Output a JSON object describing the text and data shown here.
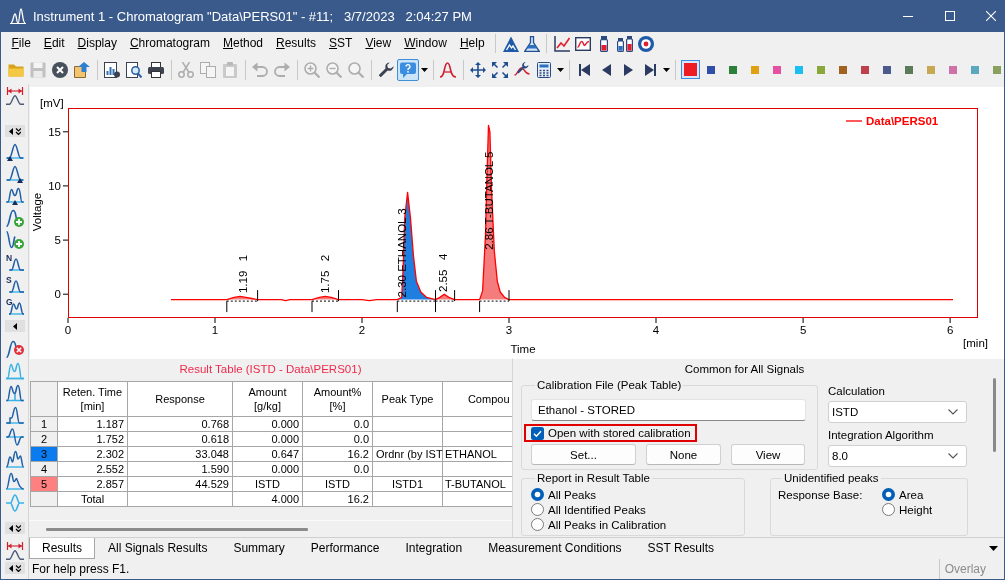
{
  "window": {
    "title": "Instrument 1 - Chromatogram \"Data\\PERS01\" - #11;   3/7/2023   2:04:27 PM"
  },
  "menu": {
    "items": [
      "File",
      "Edit",
      "Display",
      "Chromatogram",
      "Method",
      "Results",
      "SST",
      "View",
      "Window",
      "Help"
    ],
    "icon_groups": [
      [
        {
          "kind": "mountain"
        },
        {
          "kind": "flask"
        }
      ],
      [
        {
          "kind": "line-chart"
        },
        {
          "kind": "chart-window"
        },
        {
          "kind": "vial"
        },
        {
          "kind": "vials"
        },
        {
          "kind": "target"
        }
      ]
    ]
  },
  "toolbar": {
    "groups": [
      [
        {
          "kind": "open",
          "disabled": false,
          "pressed": false
        },
        {
          "kind": "save",
          "disabled": true,
          "pressed": false
        },
        {
          "kind": "close",
          "disabled": false,
          "pressed": false
        },
        {
          "kind": "export",
          "disabled": false,
          "pressed": false
        }
      ],
      [
        {
          "kind": "report",
          "disabled": false,
          "pressed": false
        },
        {
          "kind": "preview",
          "disabled": false,
          "pressed": false
        },
        {
          "kind": "print",
          "disabled": false,
          "pressed": false
        }
      ],
      [
        {
          "kind": "cut",
          "disabled": true,
          "pressed": false
        },
        {
          "kind": "copy",
          "disabled": true,
          "pressed": false
        },
        {
          "kind": "paste",
          "disabled": true,
          "pressed": false
        }
      ],
      [
        {
          "kind": "undo",
          "disabled": true,
          "pressed": false
        },
        {
          "kind": "redo",
          "disabled": true,
          "pressed": false
        }
      ],
      [
        {
          "kind": "zoom-in",
          "disabled": true,
          "pressed": false
        },
        {
          "kind": "zoom-out",
          "disabled": true,
          "pressed": false
        },
        {
          "kind": "zoom",
          "disabled": true,
          "pressed": false
        }
      ],
      [
        {
          "kind": "wrench",
          "disabled": false,
          "pressed": false
        },
        {
          "kind": "help",
          "disabled": false,
          "pressed": true
        },
        {
          "kind": "dropdown",
          "disabled": false,
          "pressed": false
        }
      ],
      [
        {
          "kind": "signal",
          "disabled": false,
          "pressed": false
        }
      ],
      [
        {
          "kind": "move",
          "disabled": false,
          "pressed": false
        },
        {
          "kind": "fit",
          "disabled": false,
          "pressed": false
        },
        {
          "kind": "tools",
          "disabled": false,
          "pressed": false
        },
        {
          "kind": "calculator",
          "disabled": false,
          "pressed": false
        },
        {
          "kind": "dropdown",
          "disabled": false,
          "pressed": false
        }
      ],
      [
        {
          "kind": "first",
          "disabled": false,
          "pressed": false
        },
        {
          "kind": "previous",
          "disabled": false,
          "pressed": false
        },
        {
          "kind": "next",
          "disabled": false,
          "pressed": false
        },
        {
          "kind": "last",
          "disabled": false,
          "pressed": false
        },
        {
          "kind": "dropdown",
          "disabled": false,
          "pressed": false
        }
      ]
    ],
    "colors": [
      {
        "color": "#ee1c24",
        "selected": true
      },
      {
        "color": "#2f4ea6",
        "selected": false
      },
      {
        "color": "#2a7f3a",
        "selected": false
      },
      {
        "color": "#e0a010",
        "selected": false
      },
      {
        "color": "#e650a0",
        "selected": false
      },
      {
        "color": "#18bff0",
        "selected": false
      },
      {
        "color": "#8aa83a",
        "selected": false
      },
      {
        "color": "#a0621e",
        "selected": false
      },
      {
        "color": "#c0404a",
        "selected": false
      },
      {
        "color": "#4a5a8a",
        "selected": false
      },
      {
        "color": "#5a7a5a",
        "selected": false
      },
      {
        "color": "#c8a850",
        "selected": false
      },
      {
        "color": "#d070a8",
        "selected": false
      },
      {
        "color": "#5aa8c0",
        "selected": false
      },
      {
        "color": "#8aa060",
        "selected": false
      }
    ]
  },
  "side_toolbar": {
    "items": [
      {
        "kind": "peak-range"
      },
      {
        "kind": "collapse"
      },
      {
        "kind": "peak-start"
      },
      {
        "kind": "peak-end"
      },
      {
        "kind": "double-peak"
      },
      {
        "kind": "peak-add"
      },
      {
        "kind": "valley-add"
      },
      {
        "kind": "lettered-peak",
        "letter": "N"
      },
      {
        "kind": "lettered-peak",
        "letter": "S"
      },
      {
        "kind": "lettered-double-peak",
        "letter": "G"
      },
      {
        "kind": "collapse-left"
      },
      {
        "kind": "peak-delete"
      },
      {
        "kind": "double-peak-baseline"
      },
      {
        "kind": "double-peak-drop"
      },
      {
        "kind": "step-peak"
      },
      {
        "kind": "wave"
      },
      {
        "kind": "triple-peak"
      },
      {
        "kind": "tail-peak"
      },
      {
        "kind": "star"
      },
      {
        "kind": "collapse"
      },
      {
        "kind": "peak-range"
      },
      {
        "kind": "collapse"
      }
    ]
  },
  "chromatogram": {
    "y_unit": "[mV]",
    "x_unit": "[min]",
    "peaks": [
      {
        "color": "#f47c7c"
      },
      {
        "color": "#f47c7c"
      },
      {
        "color": "#1e7fe0"
      },
      {
        "color": "#f47c7c"
      },
      {
        "color": "#f47c7c"
      }
    ],
    "chart_data": {
      "type": "line",
      "xlabel": "Time",
      "ylabel": "Voltage",
      "x": [
        0.7,
        1.08,
        1.13,
        1.17,
        1.21,
        1.25,
        1.29,
        1.45,
        1.48,
        1.51,
        1.66,
        1.71,
        1.75,
        1.79,
        1.84,
        2.0,
        2.05,
        2.1,
        2.24,
        2.27,
        2.28,
        2.29,
        2.31,
        2.33,
        2.35,
        2.37,
        2.4,
        2.44,
        2.5,
        2.53,
        2.56,
        2.59,
        2.63,
        2.8,
        2.82,
        2.84,
        2.85,
        2.86,
        2.87,
        2.88,
        2.9,
        2.92,
        2.94,
        2.97,
        3.0,
        6.02
      ],
      "series": [
        {
          "name": "Data\\PERS01",
          "color": "#ff0000",
          "values": [
            -0.5,
            -0.5,
            -0.3,
            -0.2,
            -0.3,
            -0.4,
            -0.5,
            -0.5,
            -0.6,
            -0.5,
            -0.5,
            -0.3,
            -0.2,
            -0.3,
            -0.5,
            -0.5,
            -0.6,
            -0.5,
            -0.5,
            -0.3,
            2.5,
            7.0,
            9.4,
            7.0,
            3.5,
            1.2,
            0.2,
            -0.3,
            -0.5,
            -0.3,
            0.0,
            -0.3,
            -0.5,
            -0.5,
            0.3,
            5.5,
            11.0,
            15.6,
            15.0,
            10.0,
            4.0,
            1.2,
            0.2,
            -0.3,
            -0.5,
            -0.5
          ]
        }
      ],
      "xlim": [
        0,
        6.19
      ],
      "ylim": [
        -2.2,
        17.2
      ],
      "xticks": [
        0,
        1,
        2,
        3,
        4,
        5,
        6
      ],
      "yticks": [
        0,
        5,
        10,
        15
      ],
      "annotations": [
        {
          "x": 1.19,
          "y": 0.1,
          "text": "1.19   1"
        },
        {
          "x": 1.75,
          "y": 0.1,
          "text": "1.75   2"
        },
        {
          "x": 2.27,
          "y": -0.3,
          "text": "2.30 ETHANOL 3"
        },
        {
          "x": 2.55,
          "y": 0.2,
          "text": "2.55   4"
        },
        {
          "x": 2.86,
          "y": 4.1,
          "text": "2.86 T-BUTANOL 5"
        }
      ]
    }
  },
  "result_table": {
    "title": "Result Table (ISTD - Data\\PERS01)",
    "columns": [
      {
        "title": "Reten. Time",
        "unit": "[min]"
      },
      {
        "title": "Response"
      },
      {
        "title": "Amount",
        "unit": "[g/kg]"
      },
      {
        "title": "Amount%",
        "unit": "[%]"
      },
      {
        "title": "Peak Type"
      },
      {
        "title": "Compou"
      }
    ],
    "rows": [
      {
        "number": "1",
        "cells": [
          "1.187",
          "0.768",
          "0.000",
          "0.0",
          null,
          null
        ]
      },
      {
        "number": "2",
        "cells": [
          "1.752",
          "0.618",
          "0.000",
          "0.0",
          null,
          null
        ]
      },
      {
        "number": "3",
        "color": "#0a7cf0",
        "cells": [
          "2.302",
          "33.048",
          "0.647",
          "16.2",
          "Ordnr (by IST",
          "ETHANOL"
        ]
      },
      {
        "number": "4",
        "cells": [
          "2.552",
          "1.590",
          "0.000",
          "0.0",
          null,
          null
        ]
      },
      {
        "number": "5",
        "color": "#ff8080",
        "cells": [
          "2.857",
          "44.529",
          "ISTD",
          "ISTD",
          "ISTD1",
          "T-BUTANOL"
        ]
      }
    ],
    "total": {
      "label": "Total",
      "cells": [
        null,
        "4.000",
        "16.2",
        null,
        null
      ]
    }
  },
  "common_panel": {
    "title": "Common for All Signals",
    "calibration_file": {
      "label": "Calibration File (Peak Table)",
      "value": "Ethanol - STORED",
      "checkbox": {
        "label": "Open with stored calibration",
        "checked": true,
        "highlighted": true
      },
      "buttons": [
        "Set...",
        "None",
        "View"
      ]
    },
    "calculation": {
      "label": "Calculation",
      "value": "ISTD"
    },
    "integration_algorithm": {
      "label": "Integration Algorithm",
      "value": "8.0"
    },
    "report": {
      "label": "Report in Result Table",
      "options": [
        {
          "label": "All Peaks",
          "selected": true
        },
        {
          "label": "All Identified Peaks",
          "selected": false
        },
        {
          "label": "All Peaks in Calibration",
          "selected": false
        }
      ]
    },
    "unidentified_peaks": {
      "label": "Unidentified peaks",
      "field_label": "Response Base:",
      "options": [
        {
          "label": "Area",
          "selected": true
        },
        {
          "label": "Height",
          "selected": false
        }
      ]
    }
  },
  "tabs": [
    {
      "label": "Results",
      "selected": true
    },
    {
      "label": "All Signals Results",
      "selected": false
    },
    {
      "label": "Summary",
      "selected": false
    },
    {
      "label": "Performance",
      "selected": false
    },
    {
      "label": "Integration",
      "selected": false
    },
    {
      "label": "Measurement Conditions",
      "selected": false
    },
    {
      "label": "SST Results",
      "selected": false
    }
  ],
  "status_bar": {
    "text": "For help press F1.",
    "indicators": [
      {
        "label": "Overlay",
        "active": false
      }
    ]
  }
}
